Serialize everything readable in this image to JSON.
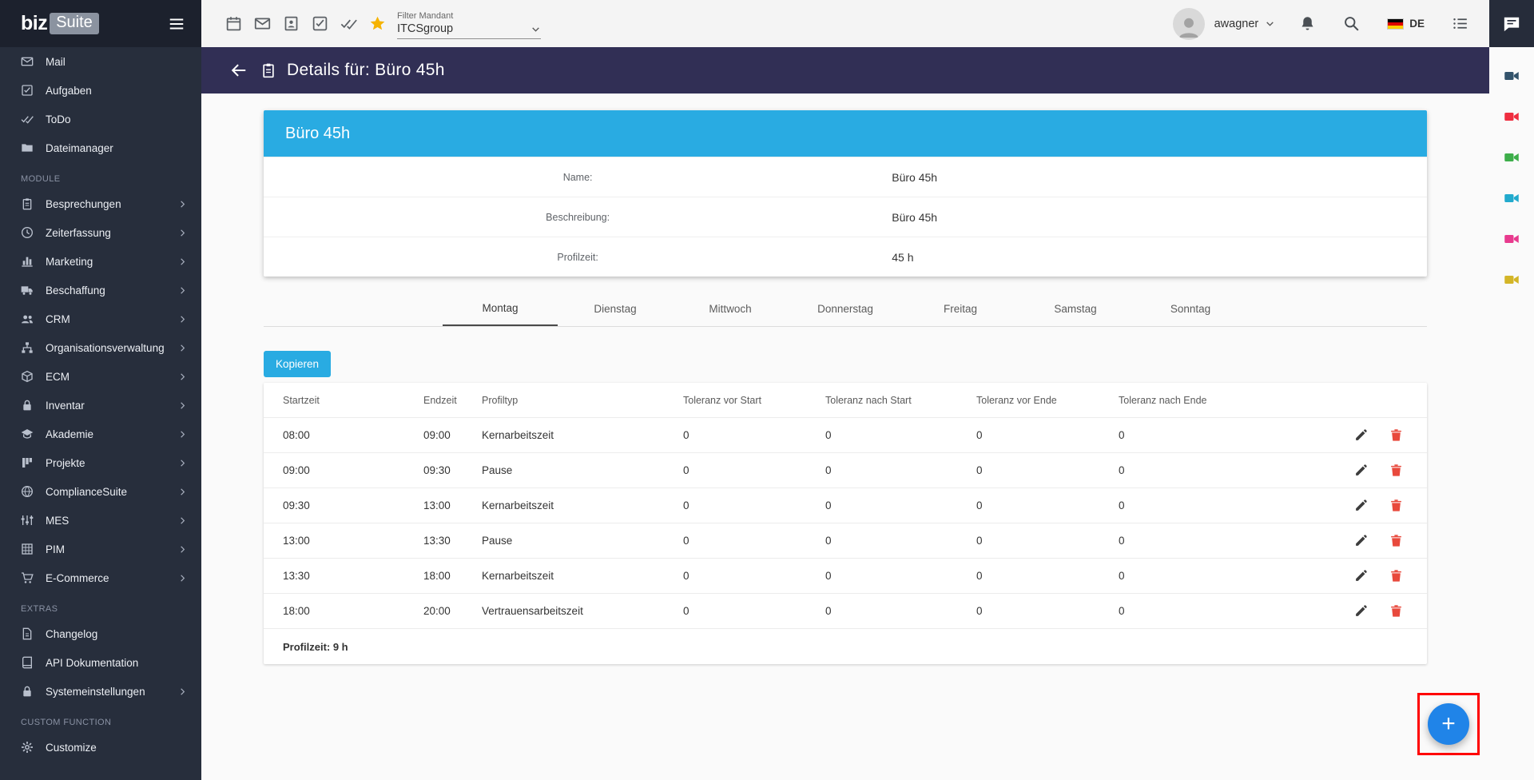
{
  "brand": {
    "biz": "biz",
    "suite": "Suite"
  },
  "topbar": {
    "filter_label": "Filter Mandant",
    "filter_value": "ITCSgroup",
    "username": "awagner",
    "language": "DE"
  },
  "page_header": {
    "title": "Details für: Büro 45h"
  },
  "profile_card": {
    "title": "Büro 45h",
    "rows": [
      {
        "label": "Name:",
        "value": "Büro 45h"
      },
      {
        "label": "Beschreibung:",
        "value": "Büro 45h"
      },
      {
        "label": "Profilzeit:",
        "value": "45 h"
      }
    ]
  },
  "tabs": {
    "items": [
      "Montag",
      "Dienstag",
      "Mittwoch",
      "Donnerstag",
      "Freitag",
      "Samstag",
      "Sonntag"
    ],
    "active": "Montag"
  },
  "actions": {
    "copy_button": "Kopieren",
    "add_button": "+"
  },
  "schedule_table": {
    "headers": [
      "Startzeit",
      "Endzeit",
      "Profiltyp",
      "Toleranz vor Start",
      "Toleranz nach Start",
      "Toleranz vor Ende",
      "Toleranz nach Ende"
    ],
    "rows": [
      [
        "08:00",
        "09:00",
        "Kernarbeitszeit",
        "0",
        "0",
        "0",
        "0"
      ],
      [
        "09:00",
        "09:30",
        "Pause",
        "0",
        "0",
        "0",
        "0"
      ],
      [
        "09:30",
        "13:00",
        "Kernarbeitszeit",
        "0",
        "0",
        "0",
        "0"
      ],
      [
        "13:00",
        "13:30",
        "Pause",
        "0",
        "0",
        "0",
        "0"
      ],
      [
        "13:30",
        "18:00",
        "Kernarbeitszeit",
        "0",
        "0",
        "0",
        "0"
      ],
      [
        "18:00",
        "20:00",
        "Vertrauensarbeitszeit",
        "0",
        "0",
        "0",
        "0"
      ]
    ],
    "footer": "Profilzeit: 9 h"
  },
  "sidebar": {
    "top_items": [
      {
        "label": "Mail"
      },
      {
        "label": "Aufgaben"
      },
      {
        "label": "ToDo"
      },
      {
        "label": "Dateimanager"
      }
    ],
    "sections": [
      {
        "title": "MODULE",
        "items": [
          {
            "label": "Besprechungen"
          },
          {
            "label": "Zeiterfassung"
          },
          {
            "label": "Marketing"
          },
          {
            "label": "Beschaffung"
          },
          {
            "label": "CRM"
          },
          {
            "label": "Organisationsverwaltung"
          },
          {
            "label": "ECM"
          },
          {
            "label": "Inventar"
          },
          {
            "label": "Akademie"
          },
          {
            "label": "Projekte"
          },
          {
            "label": "ComplianceSuite"
          },
          {
            "label": "MES"
          },
          {
            "label": "PIM"
          },
          {
            "label": "E-Commerce"
          }
        ]
      },
      {
        "title": "EXTRAS",
        "items": [
          {
            "label": "Changelog"
          },
          {
            "label": "API Dokumentation"
          },
          {
            "label": "Systemeinstellungen"
          }
        ]
      },
      {
        "title": "CUSTOM FUNCTION",
        "items": [
          {
            "label": "Customize"
          }
        ]
      }
    ]
  },
  "colors": {
    "accent": "#29abe2",
    "page_header_bg": "#312f55",
    "sidebar_bg": "#272e3c",
    "fab_bg": "#2084e8",
    "fab_highlight": "#ff0000",
    "star": "#f5b301",
    "delete": "#e8493c",
    "video_icons": [
      "#33536b",
      "#ef2e40",
      "#3dae4a",
      "#22aacd",
      "#e83a8e",
      "#d3b527"
    ]
  }
}
